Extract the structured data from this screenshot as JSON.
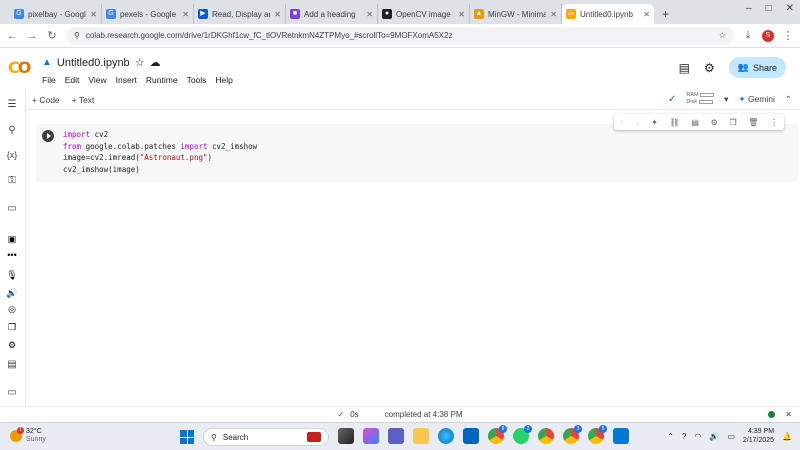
{
  "browser": {
    "tabs": [
      {
        "title": "pixelbay - Googl",
        "favicon": "G",
        "color": "#4285f4"
      },
      {
        "title": "pexels - Google",
        "favicon": "G",
        "color": "#4285f4"
      },
      {
        "title": "Read, Display an",
        "favicon": "▶",
        "color": "#0b57d0"
      },
      {
        "title": "Add a heading",
        "favicon": "■",
        "color": "#7b3fe4"
      },
      {
        "title": "OpenCV image",
        "favicon": "●",
        "color": "#202124"
      },
      {
        "title": "MinGW - Minima",
        "favicon": "▲",
        "color": "#f29900"
      },
      {
        "title": "Untitled0.ipynb",
        "favicon": "co",
        "color": "#f9ab00"
      }
    ],
    "new_tab": "+",
    "window_controls": [
      "–",
      "□",
      "✕"
    ],
    "url": "colab.research.google.com/drive/1rDKGhf1cw_fC_tlOVRetnkmN4ZTPMyo_#scrollTo=9MOFXomA5X2z",
    "profile_initial": "S"
  },
  "colab": {
    "notebook_title": "Untitled0.ipynb",
    "menu": [
      "File",
      "Edit",
      "View",
      "Insert",
      "Runtime",
      "Tools",
      "Help"
    ],
    "share_label": "Share",
    "toolbar": {
      "add_code": "+ Code",
      "add_text": "+ Text",
      "ram": "RAM",
      "disk": "Disk",
      "gemini": "Gemini"
    },
    "cell": {
      "lines": {
        "l1_kw": "import",
        "l1_rest": " cv2",
        "l2_kw": "from",
        "l2_mid": " google.colab.patches ",
        "l2_kw2": "import",
        "l2_rest": " cv2_imshow",
        "l3_pre": "image=cv2.imread(",
        "l3_str": "\"Astronaut.png\"",
        "l3_post": ")",
        "l4": "cv2_imshow(image)"
      }
    },
    "status": {
      "check": "✓",
      "duration": "0s",
      "completed": "completed at 4:38 PM"
    }
  },
  "taskbar": {
    "weather_temp": "32°C",
    "weather_desc": "Sunny",
    "weather_badge": "1",
    "search_placeholder": "Search",
    "time": "4:39 PM",
    "date": "2/17/2025"
  }
}
